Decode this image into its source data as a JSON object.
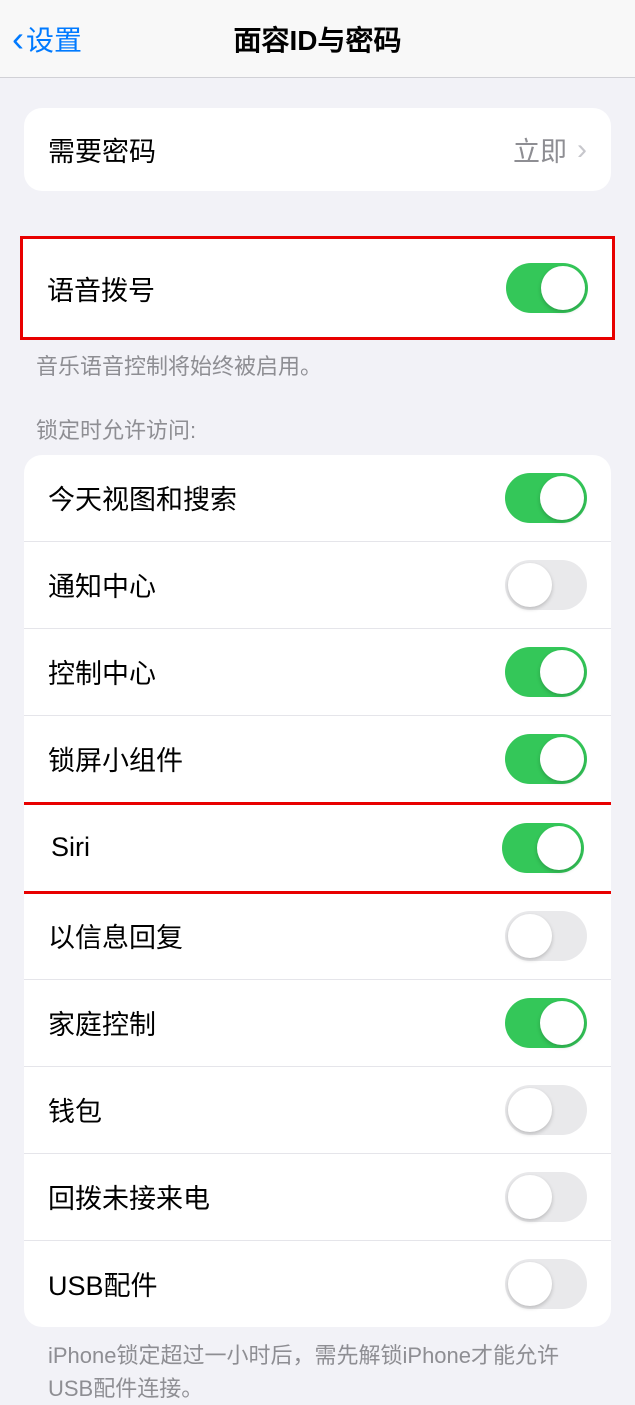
{
  "header": {
    "back_label": "设置",
    "title": "面容ID与密码"
  },
  "passcode": {
    "label": "需要密码",
    "value": "立即"
  },
  "voiceDial": {
    "label": "语音拨号",
    "on": true,
    "footer": "音乐语音控制将始终被启用。"
  },
  "lockAccess": {
    "header": "锁定时允许访问:",
    "items": [
      {
        "label": "今天视图和搜索",
        "on": true,
        "highlight": false
      },
      {
        "label": "通知中心",
        "on": false,
        "highlight": false
      },
      {
        "label": "控制中心",
        "on": true,
        "highlight": false
      },
      {
        "label": "锁屏小组件",
        "on": true,
        "highlight": false
      },
      {
        "label": "Siri",
        "on": true,
        "highlight": true
      },
      {
        "label": "以信息回复",
        "on": false,
        "highlight": false
      },
      {
        "label": "家庭控制",
        "on": true,
        "highlight": false
      },
      {
        "label": "钱包",
        "on": false,
        "highlight": false
      },
      {
        "label": "回拨未接来电",
        "on": false,
        "highlight": false
      },
      {
        "label": "USB配件",
        "on": false,
        "highlight": false
      }
    ],
    "footer": "iPhone锁定超过一小时后，需先解锁iPhone才能允许USB配件连接。"
  }
}
